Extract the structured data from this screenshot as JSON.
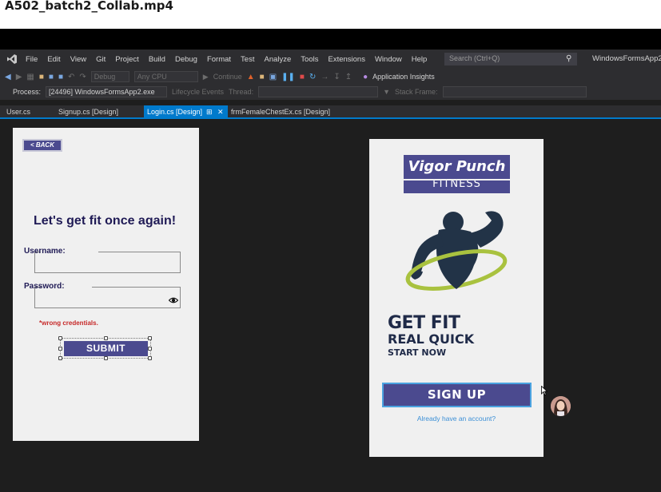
{
  "video_title": "A502_batch2_Collab.mp4",
  "menu": {
    "items": [
      "File",
      "Edit",
      "View",
      "Git",
      "Project",
      "Build",
      "Debug",
      "Format",
      "Test",
      "Analyze",
      "Tools",
      "Extensions",
      "Window",
      "Help"
    ],
    "search_placeholder": "Search (Ctrl+Q)",
    "solution_name": "WindowsFormsApp2"
  },
  "toolbar": {
    "config": "Debug",
    "platform": "Any CPU",
    "continue_label": "Continue",
    "app_insights": "Application Insights",
    "process_label": "Process:",
    "process_value": "[24496] WindowsFormsApp2.exe",
    "lifecycle_label": "Lifecycle Events",
    "thread_label": "Thread:",
    "stack_label": "Stack Frame:"
  },
  "tabs": [
    {
      "label": "User.cs"
    },
    {
      "label": "Signup.cs [Design]"
    },
    {
      "label": "Login.cs [Design]"
    },
    {
      "label": "frmFemaleChestEx.cs [Design]"
    }
  ],
  "login_form": {
    "back_label": "< BACK",
    "heading": "Let's get fit once again!",
    "username_label": "Username:",
    "password_label": "Password:",
    "error_text": "*wrong credentials.",
    "submit_label": "SUBMIT"
  },
  "signup_form": {
    "logo_title": "Vigor Punch",
    "logo_sub": "FITNESS",
    "line1": "GET FIT",
    "line2": "REAL QUICK",
    "line3": "START NOW",
    "signup_label": "SIGN UP",
    "have_account": "Already have an account?"
  },
  "colors": {
    "brand_purple": "#4b4a8f",
    "heading_navy": "#1f1a55",
    "vs_accent": "#007acc",
    "error_red": "#c62828",
    "link_blue": "#3b8fd6"
  }
}
